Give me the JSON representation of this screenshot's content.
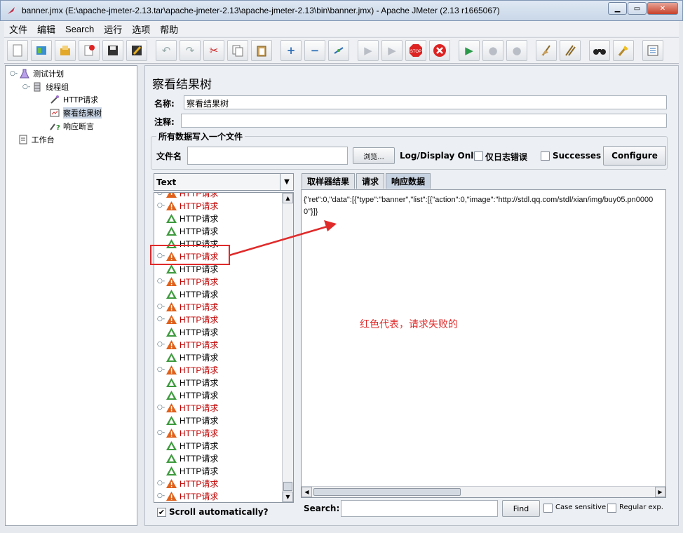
{
  "window": {
    "title": "banner.jmx (E:\\apache-jmeter-2.13.tar\\apache-jmeter-2.13\\apache-jmeter-2.13\\bin\\banner.jmx) - Apache JMeter (2.13 r1665067)",
    "minimize": "▁",
    "maximize": "▭",
    "close": "✕"
  },
  "menu": [
    "文件",
    "编辑",
    "Search",
    "运行",
    "选项",
    "帮助"
  ],
  "tree": {
    "test_plan": "测试计划",
    "thread_group": "线程组",
    "http_request": "HTTP请求",
    "result_tree": "察看结果树",
    "assertion": "响应断言",
    "workbench": "工作台"
  },
  "panel": {
    "title": "察看结果树",
    "name_label": "名称:",
    "name_value": "察看结果树",
    "comment_label": "注释:",
    "comment_value": "",
    "file_group_title": "所有数据写入一个文件",
    "filename_label": "文件名",
    "filename_value": "",
    "browse_label": "浏览...",
    "log_display_label": "Log/Display Only:",
    "errors_only_label": "仅日志错误",
    "successes_label": "Successes",
    "configure_label": "Configure"
  },
  "results": {
    "renderer": "Text",
    "scroll_auto_label": "Scroll automatically?",
    "partial_top_label": "HTTP请求",
    "items": [
      {
        "label": "HTTP请求",
        "status": "fail"
      },
      {
        "label": "HTTP请求",
        "status": "success"
      },
      {
        "label": "HTTP请求",
        "status": "success"
      },
      {
        "label": "HTTP请求",
        "status": "success"
      },
      {
        "label": "HTTP请求",
        "status": "fail"
      },
      {
        "label": "HTTP请求",
        "status": "success"
      },
      {
        "label": "HTTP请求",
        "status": "fail"
      },
      {
        "label": "HTTP请求",
        "status": "success"
      },
      {
        "label": "HTTP请求",
        "status": "fail"
      },
      {
        "label": "HTTP请求",
        "status": "fail"
      },
      {
        "label": "HTTP请求",
        "status": "success"
      },
      {
        "label": "HTTP请求",
        "status": "fail"
      },
      {
        "label": "HTTP请求",
        "status": "success"
      },
      {
        "label": "HTTP请求",
        "status": "fail"
      },
      {
        "label": "HTTP请求",
        "status": "success"
      },
      {
        "label": "HTTP请求",
        "status": "success"
      },
      {
        "label": "HTTP请求",
        "status": "fail"
      },
      {
        "label": "HTTP请求",
        "status": "success"
      },
      {
        "label": "HTTP请求",
        "status": "fail"
      },
      {
        "label": "HTTP请求",
        "status": "success"
      },
      {
        "label": "HTTP请求",
        "status": "success"
      },
      {
        "label": "HTTP请求",
        "status": "success"
      },
      {
        "label": "HTTP请求",
        "status": "fail"
      },
      {
        "label": "HTTP请求",
        "status": "fail"
      }
    ]
  },
  "detail": {
    "tabs": [
      "取样器结果",
      "请求",
      "响应数据"
    ],
    "active_tab": "响应数据",
    "response_text": "{\"ret\":0,\"data\":[{\"type\":\"banner\",\"list\":[{\"action\":0,\"image\":\"http://stdl.qq.com/stdl/xian/img/buy05.pn00000\"}]}",
    "search_label": "Search:",
    "search_value": "",
    "find_label": "Find",
    "case_sensitive_label": "Case sensitive",
    "regex_label": "Regular exp."
  },
  "annotation": {
    "text": "红色代表，请求失败的",
    "color": "#e02a2a"
  },
  "colors": {
    "fail_text": "#c00000",
    "success_icon": "#3e9a3e",
    "fail_icon": "#e0601a"
  }
}
